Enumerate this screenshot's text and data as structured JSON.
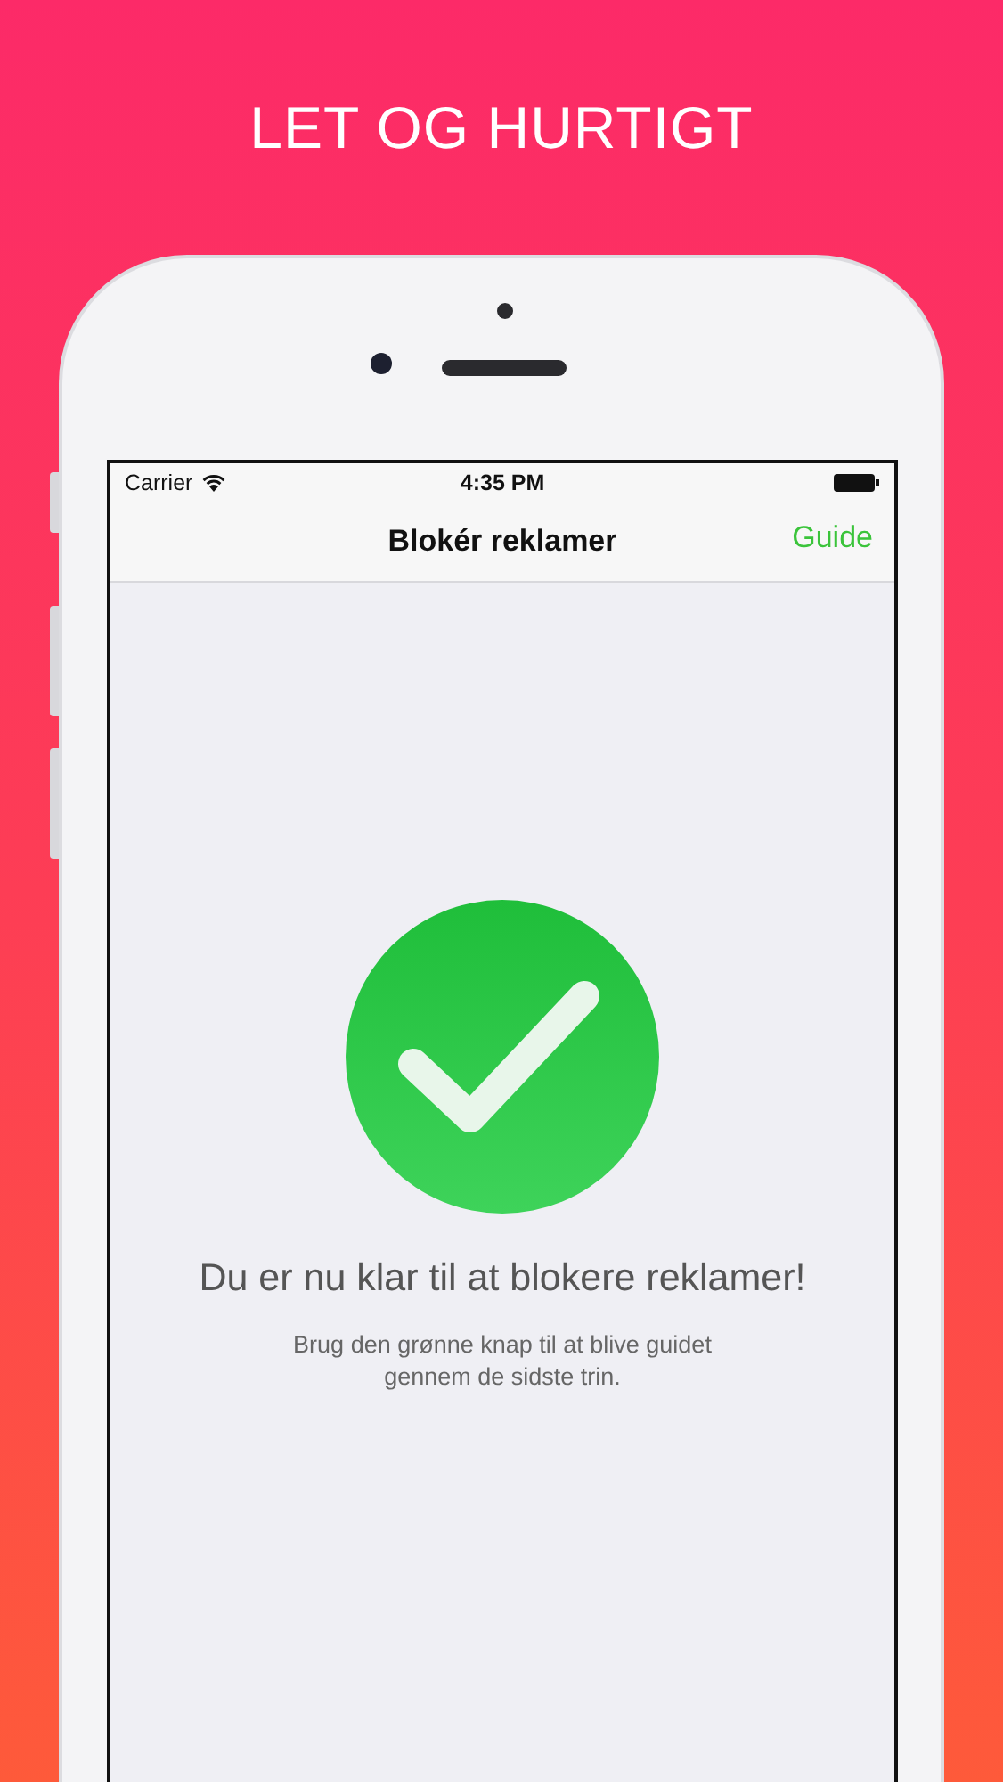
{
  "headline": "LET OG HURTIGT",
  "status_bar": {
    "carrier": "Carrier",
    "time": "4:35 PM"
  },
  "nav_bar": {
    "title": "Blokér reklamer",
    "action": "Guide"
  },
  "message": {
    "title": "Du er nu klar til at blokere reklamer!",
    "body": "Brug den grønne knap til at blive guidet gennem de sidste trin."
  }
}
